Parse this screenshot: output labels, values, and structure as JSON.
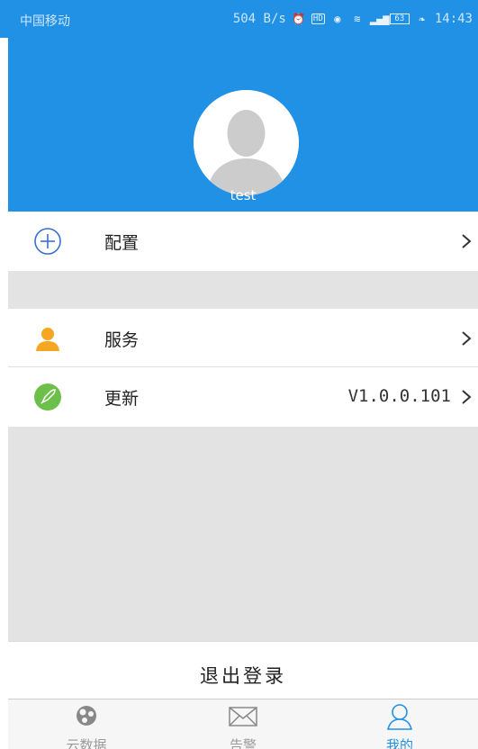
{
  "status_bar": {
    "carrier": "中国移动",
    "speed": "504 B/s",
    "battery": "63",
    "time": "14:43",
    "icons": [
      "alarm-icon",
      "hd-icon",
      "eye-icon",
      "wifi-icon",
      "signal-4g-icon",
      "battery-icon",
      "leaf-icon"
    ]
  },
  "profile": {
    "username": "test",
    "avatar_icon": "default-avatar-icon"
  },
  "menu": {
    "config": {
      "label": "配置",
      "icon": "plus-circle-icon"
    },
    "service": {
      "label": "服务",
      "icon": "user-icon"
    },
    "update": {
      "label": "更新",
      "value": "V1.0.0.101",
      "icon": "rocket-icon"
    }
  },
  "logout": {
    "label": "退出登录"
  },
  "tabs": [
    {
      "label": "云数据",
      "icon": "cloud-data-icon",
      "active": false
    },
    {
      "label": "告警",
      "icon": "mail-icon",
      "active": false
    },
    {
      "label": "我的",
      "icon": "person-outline-icon",
      "active": true
    }
  ],
  "colors": {
    "primary": "#2191e6",
    "background_gray": "#e3e3e3",
    "service_icon": "#f5a623",
    "update_icon": "#6cc04a"
  }
}
